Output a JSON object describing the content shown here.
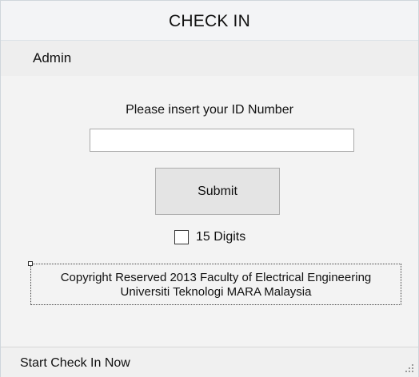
{
  "window": {
    "title": "CHECK IN"
  },
  "menubar": {
    "items": [
      {
        "label": "Admin"
      }
    ]
  },
  "form": {
    "prompt": "Please insert your ID Number",
    "id_input": {
      "value": "",
      "placeholder": ""
    },
    "submit_label": "Submit",
    "digits_checkbox": {
      "label": "15 Digits",
      "checked": false
    }
  },
  "copyright": {
    "line1": "Copyright Reserved 2013 Faculty of Electrical Engineering",
    "line2": "Universiti Teknologi MARA Malaysia"
  },
  "statusbar": {
    "text": "Start Check In Now",
    "grip_icon": "resize-grip-icon"
  }
}
